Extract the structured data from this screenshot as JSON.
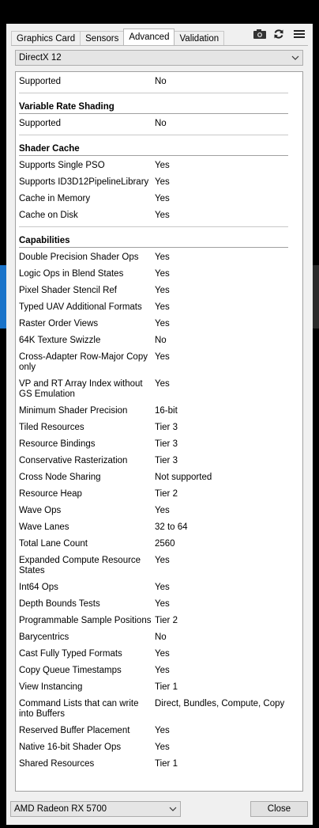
{
  "tabs": [
    {
      "label": "Graphics Card",
      "active": false
    },
    {
      "label": "Sensors",
      "active": false
    },
    {
      "label": "Advanced",
      "active": true
    },
    {
      "label": "Validation",
      "active": false
    }
  ],
  "toolbar": {
    "icons": [
      "camera-icon",
      "refresh-icon",
      "menu-icon"
    ]
  },
  "api_select": {
    "value": "DirectX 12"
  },
  "sections": {
    "top": {
      "rows": [
        {
          "k": "Supported",
          "v": "No"
        }
      ]
    },
    "vrs": {
      "title": "Variable Rate Shading",
      "rows": [
        {
          "k": "Supported",
          "v": "No"
        }
      ]
    },
    "shader_cache": {
      "title": "Shader Cache",
      "rows": [
        {
          "k": "Supports Single PSO",
          "v": "Yes"
        },
        {
          "k": "Supports ID3D12PipelineLibrary",
          "v": "Yes"
        },
        {
          "k": "Cache in Memory",
          "v": "Yes"
        },
        {
          "k": "Cache on Disk",
          "v": "Yes"
        }
      ]
    },
    "capabilities": {
      "title": "Capabilities",
      "rows": [
        {
          "k": "Double Precision Shader Ops",
          "v": "Yes"
        },
        {
          "k": "Logic Ops in Blend States",
          "v": "Yes"
        },
        {
          "k": "Pixel Shader Stencil Ref",
          "v": "Yes"
        },
        {
          "k": "Typed UAV Additional Formats",
          "v": "Yes"
        },
        {
          "k": "Raster Order Views",
          "v": "Yes"
        },
        {
          "k": "64K Texture Swizzle",
          "v": "No"
        },
        {
          "k": "Cross-Adapter Row-Major Copy only",
          "v": "Yes"
        },
        {
          "k": "VP and RT Array Index without GS Emulation",
          "v": "Yes"
        },
        {
          "k": "Minimum Shader Precision",
          "v": "16-bit"
        },
        {
          "k": "Tiled Resources",
          "v": "Tier 3"
        },
        {
          "k": "Resource Bindings",
          "v": "Tier 3"
        },
        {
          "k": "Conservative Rasterization",
          "v": "Tier 3"
        },
        {
          "k": "Cross Node Sharing",
          "v": "Not supported"
        },
        {
          "k": "Resource Heap",
          "v": "Tier 2"
        },
        {
          "k": "Wave Ops",
          "v": "Yes"
        },
        {
          "k": "Wave Lanes",
          "v": "32 to 64"
        },
        {
          "k": "Total Lane Count",
          "v": "2560"
        },
        {
          "k": "Expanded Compute Resource States",
          "v": "Yes"
        },
        {
          "k": "Int64 Ops",
          "v": "Yes"
        },
        {
          "k": "Depth Bounds Tests",
          "v": "Yes"
        },
        {
          "k": "Programmable Sample Positions",
          "v": "Tier 2"
        },
        {
          "k": "Barycentrics",
          "v": "No"
        },
        {
          "k": "Cast Fully Typed Formats",
          "v": "Yes"
        },
        {
          "k": "Copy Queue Timestamps",
          "v": "Yes"
        },
        {
          "k": "View Instancing",
          "v": "Tier 1"
        },
        {
          "k": "Command Lists that can write into Buffers",
          "v": "Direct, Bundles, Compute, Copy"
        },
        {
          "k": "Reserved Buffer Placement",
          "v": "Yes"
        },
        {
          "k": "Native 16-bit Shader Ops",
          "v": "Yes"
        },
        {
          "k": "Shared Resources",
          "v": "Tier 1"
        }
      ]
    }
  },
  "footer": {
    "gpu_select": "AMD Radeon RX 5700",
    "close_label": "Close"
  }
}
